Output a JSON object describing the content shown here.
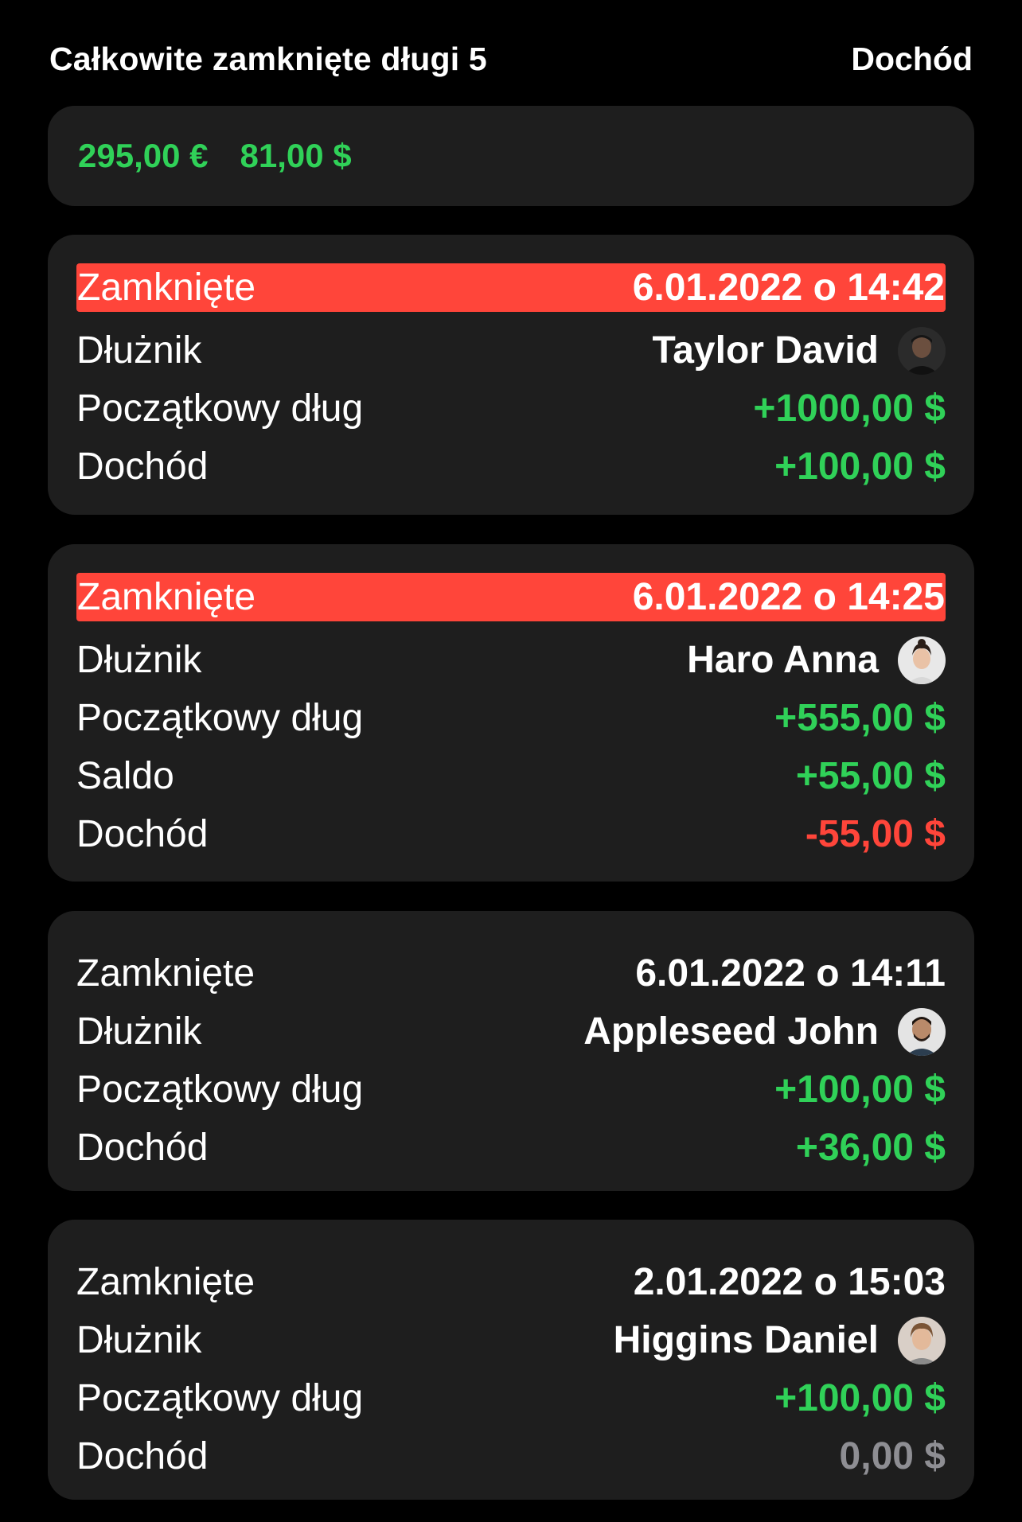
{
  "header": {
    "title": "Całkowite zamknięte długi 5",
    "right_label": "Dochód"
  },
  "summary": {
    "amounts": [
      "295,00 €",
      "81,00 $"
    ]
  },
  "cards": [
    {
      "closed_label": "Zamknięte",
      "closed_date": "6.01.2022 o 14:42",
      "highlighted": true,
      "debtor_label": "Dłużnik",
      "debtor_name": "Taylor David",
      "avatar_icon": "avatar-taylor-david",
      "initial_label": "Początkowy dług",
      "initial_value": "+1000,00 $",
      "income_label": "Dochód",
      "income_value": "+100,00 $",
      "income_color": "#30d158"
    },
    {
      "closed_label": "Zamknięte",
      "closed_date": "6.01.2022 o 14:25",
      "highlighted": true,
      "debtor_label": "Dłużnik",
      "debtor_name": "Haro Anna",
      "avatar_icon": "avatar-haro-anna",
      "initial_label": "Początkowy dług",
      "initial_value": "+555,00 $",
      "balance_label": "Saldo",
      "balance_value": "+55,00 $",
      "income_label": "Dochód",
      "income_value": "-55,00 $",
      "income_color": "#ff453a"
    },
    {
      "closed_label": "Zamknięte",
      "closed_date": "6.01.2022 o 14:11",
      "highlighted": false,
      "debtor_label": "Dłużnik",
      "debtor_name": "Appleseed John",
      "avatar_icon": "avatar-appleseed-john",
      "initial_label": "Początkowy dług",
      "initial_value": "+100,00 $",
      "income_label": "Dochód",
      "income_value": "+36,00 $",
      "income_color": "#30d158"
    },
    {
      "closed_label": "Zamknięte",
      "closed_date": "2.01.2022 o 15:03",
      "highlighted": false,
      "debtor_label": "Dłużnik",
      "debtor_name": "Higgins Daniel",
      "avatar_icon": "avatar-higgins-daniel",
      "initial_label": "Początkowy dług",
      "initial_value": "+100,00 $",
      "income_label": "Dochód",
      "income_value": "0,00 $",
      "income_color": "#8e8e93"
    }
  ],
  "colors": {
    "background": "#000000",
    "card": "#1e1e1e",
    "positive": "#30d158",
    "negative": "#ff453a",
    "neutral": "#8e8e93",
    "highlight": "#ff453a"
  }
}
